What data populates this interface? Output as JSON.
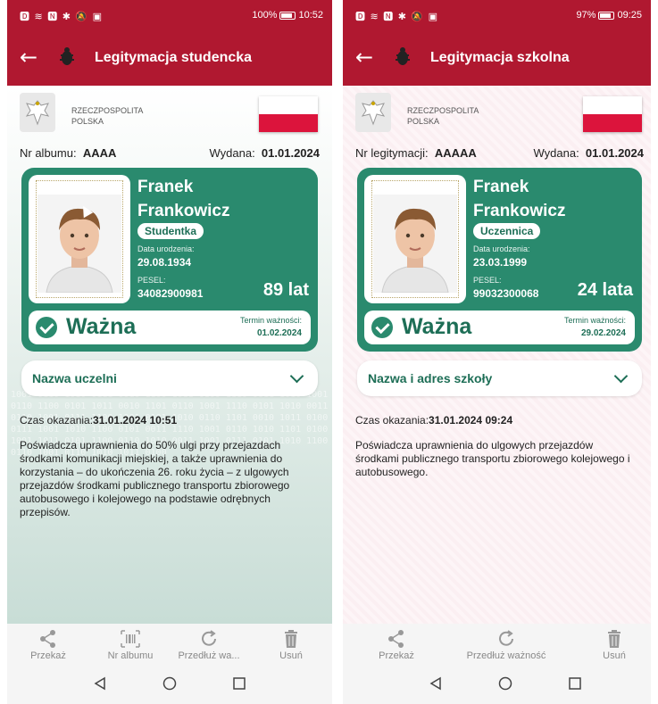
{
  "left": {
    "status": {
      "icons": "🅳 ≋ 🅽 ✱ 🔕 ▣",
      "battery": "100%",
      "time": "10:52"
    },
    "title": "Legitymacja studencka",
    "country_line1": "RZECZPOSPOLITA",
    "country_line2": "POLSKA",
    "id_label": "Nr albumu:",
    "id_value": "AAAA",
    "issued_label": "Wydana:",
    "issued_value": "01.01.2024",
    "first_name": "Franek",
    "last_name": "Frankowicz",
    "role": "Studentka",
    "dob_label": "Data urodzenia:",
    "dob": "29.08.1934",
    "pesel_label": "PESEL:",
    "pesel": "34082900981",
    "age": "89 lat",
    "valid": "Ważna",
    "expiry_label": "Termin ważności:",
    "expiry": "01.02.2024",
    "accordion": "Nazwa uczelni",
    "shown_label": "Czas okazania:",
    "shown_value": "31.01.2024 10:51",
    "description": "Poświadcza uprawnienia do 50% ulgi przy przejazdach środkami komunikacji miejskiej, a także uprawnienia do korzystania – do ukończenia 26. roku życia – z ulgowych przejazdów środkami publicznego transportu zbiorowego autobusowego i kolejowego na podstawie odrębnych przepisów.",
    "binary": "1001 0110 1010 0111 0010 1100 1011 0100 1110 0011 1010 1001 0110 1100 0101 1011 0010 1101 0110 1001 1110 0101 1010 0011 0110 1001 0111 1100 1001 0101 1010 0110 1101 0010 1011 0100 0111 1001 1010 1100 0101 0011 1110 1001 0110 1010 1101 0100 1001 1011 0101 1100 0110 1010 0011 1001 0111 0101 1010 1100 0110 1001 0110 1010 1011 0100",
    "nav": [
      {
        "label": "Przekaż",
        "icon": "share-icon"
      },
      {
        "label": "Nr albumu",
        "icon": "barcode-icon"
      },
      {
        "label": "Przedłuż wa...",
        "icon": "refresh-icon"
      },
      {
        "label": "Usuń",
        "icon": "trash-icon"
      }
    ]
  },
  "right": {
    "status": {
      "icons": "🅳 ≋ 🅽 ✱ 🔕 ▣",
      "battery": "97%",
      "time": "09:25"
    },
    "title": "Legitymacja szkolna",
    "country_line1": "RZECZPOSPOLITA",
    "country_line2": "POLSKA",
    "id_label": "Nr legitymacji:",
    "id_value": "AAAAA",
    "issued_label": "Wydana:",
    "issued_value": "01.01.2024",
    "first_name": "Franek",
    "last_name": "Frankowicz",
    "role": "Uczennica",
    "dob_label": "Data urodzenia:",
    "dob": "23.03.1999",
    "pesel_label": "PESEL:",
    "pesel": "99032300068",
    "age": "24 lata",
    "valid": "Ważna",
    "expiry_label": "Termin ważności:",
    "expiry": "29.02.2024",
    "accordion": "Nazwa i adres szkoły",
    "shown_label": "Czas okazania:",
    "shown_value": "31.01.2024 09:24",
    "description": "Poświadcza uprawnienia do ulgowych przejazdów środkami publicznego transportu zbiorowego kolejowego i autobusowego.",
    "nav": [
      {
        "label": "Przekaż",
        "icon": "share-icon"
      },
      {
        "label": "Przedłuż ważność",
        "icon": "refresh-icon"
      },
      {
        "label": "Usuń",
        "icon": "trash-icon"
      }
    ]
  },
  "colors": {
    "header": "#b01830",
    "card": "#2a8a6e",
    "accent_text": "#1d6e56"
  }
}
